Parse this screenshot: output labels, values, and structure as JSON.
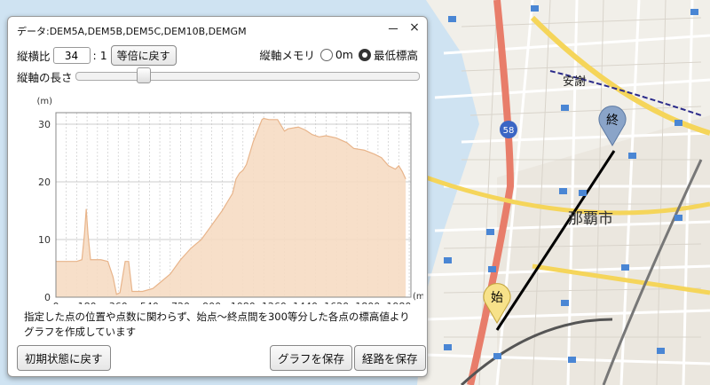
{
  "panel": {
    "title": "データ:DEM5A,DEM5B,DEM5C,DEM10B,DEMGM",
    "minimize_label": "－",
    "close_label": "×",
    "ratio_label": "縦横比",
    "ratio_value": "34",
    "ratio_suffix": ": 1",
    "reset_ratio_button": "等倍に戻す",
    "axis_memori_label": "縦軸メモリ",
    "radio_zero_label": "0m",
    "radio_min_label": "最低標高",
    "radio_selected": "min",
    "axis_length_label": "縦軸の長さ",
    "axis_length_slider_fraction": 0.18,
    "note_line1": "指定した点の位置や点数に関わらず、始点～終点間を300等分した各点の標高値より",
    "note_line2": "グラフを作成しています",
    "reset_button": "初期状態に戻す",
    "save_graph_button": "グラフを保存",
    "save_route_button": "経路を保存"
  },
  "map": {
    "labels": {
      "district": "安謝",
      "city": "那覇市",
      "route": "58",
      "start_marker": "始",
      "end_marker": "終"
    }
  },
  "chart_data": {
    "type": "area",
    "xunit": "(m)",
    "yunit": "(m)",
    "xlim": [
      0,
      2050
    ],
    "ylim": [
      0,
      32
    ],
    "xticks": [
      0,
      180,
      360,
      540,
      720,
      900,
      1080,
      1260,
      1440,
      1620,
      1800,
      1980
    ],
    "yticks": [
      0,
      10,
      20,
      30
    ],
    "fill_color": "#f6dcc3",
    "line_color": "#e8b48a",
    "x": [
      0,
      60,
      120,
      150,
      165,
      175,
      185,
      200,
      260,
      300,
      330,
      350,
      370,
      400,
      420,
      440,
      460,
      500,
      560,
      600,
      660,
      720,
      780,
      840,
      900,
      960,
      1020,
      1040,
      1060,
      1080,
      1100,
      1120,
      1140,
      1160,
      1190,
      1200,
      1230,
      1280,
      1320,
      1340,
      1400,
      1440,
      1480,
      1520,
      1560,
      1620,
      1680,
      1720,
      1780,
      1840,
      1880,
      1920,
      1960,
      1980,
      2000,
      2020
    ],
    "y": [
      6.2,
      6.2,
      6.2,
      6.5,
      11.0,
      15.3,
      11.0,
      6.5,
      6.5,
      6.2,
      3.5,
      0.5,
      0.8,
      6.2,
      6.2,
      1.0,
      1.0,
      1.0,
      1.5,
      2.5,
      4.0,
      6.5,
      8.5,
      10.0,
      12.5,
      15.0,
      18.0,
      20.5,
      21.5,
      22.0,
      23.0,
      25.0,
      27.0,
      28.5,
      30.8,
      31.0,
      30.8,
      30.8,
      28.8,
      29.2,
      29.5,
      29.0,
      28.2,
      27.8,
      28.0,
      27.6,
      26.8,
      25.8,
      25.5,
      24.8,
      24.2,
      22.8,
      22.2,
      22.8,
      21.8,
      20.5
    ]
  }
}
